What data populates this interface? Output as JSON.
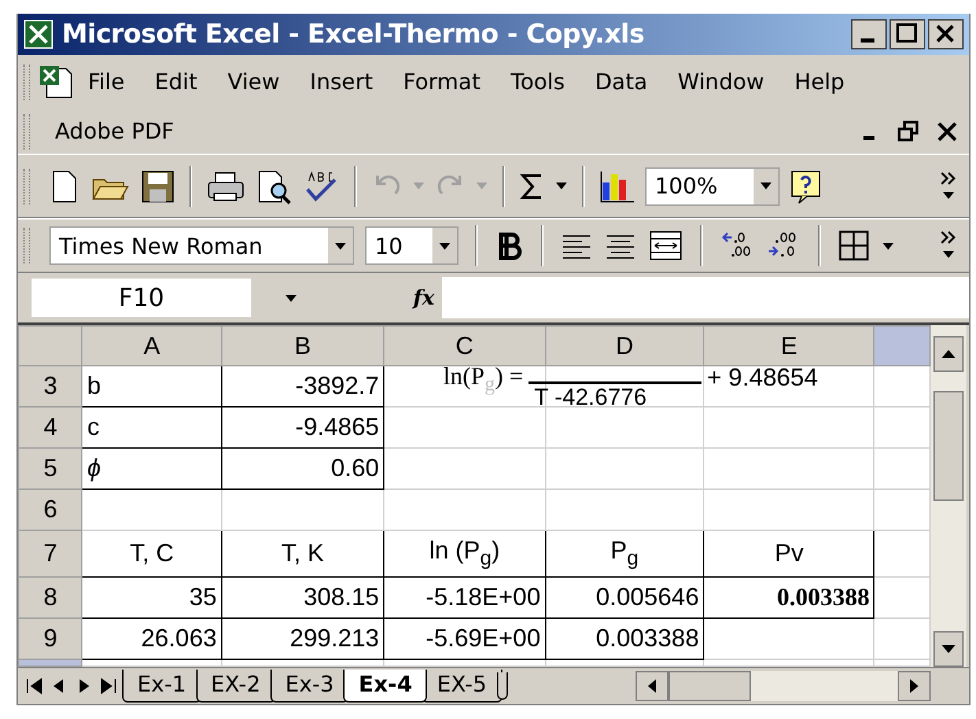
{
  "window": {
    "title": "Microsoft Excel - Excel-Thermo - Copy.xls"
  },
  "menu": [
    {
      "label": "File"
    },
    {
      "label": "Edit"
    },
    {
      "label": "View"
    },
    {
      "label": "Insert"
    },
    {
      "label": "Format"
    },
    {
      "label": "Tools"
    },
    {
      "label": "Data"
    },
    {
      "label": "Window"
    },
    {
      "label": "Help"
    }
  ],
  "second_menu": [
    {
      "label": "Adobe PDF"
    }
  ],
  "standard_toolbar": {
    "zoom": "100%",
    "undo_disabled": true
  },
  "formatting_toolbar": {
    "font": "Times New Roman",
    "size": "10"
  },
  "formula_bar": {
    "name_box": "F10",
    "fx": "fx"
  },
  "columns": [
    {
      "label": "A",
      "selected": false
    },
    {
      "label": "B",
      "selected": false
    },
    {
      "label": "C",
      "selected": false
    },
    {
      "label": "D",
      "selected": false
    },
    {
      "label": "E",
      "selected": false
    }
  ],
  "partial_column": {
    "selected": true
  },
  "rows": [
    {
      "number": "3",
      "cells": [
        {
          "text": "b",
          "kind": "label",
          "bold": false,
          "boxed": true
        },
        {
          "text": "-3892.7",
          "kind": "number",
          "bold": false,
          "boxed": true
        },
        {},
        {},
        {}
      ]
    },
    {
      "number": "4",
      "cells": [
        {
          "text": "c",
          "kind": "label",
          "bold": false,
          "boxed": true
        },
        {
          "text": "-9.4865",
          "kind": "number",
          "bold": false,
          "boxed": true
        },
        {},
        {},
        {}
      ]
    },
    {
      "number": "5",
      "cells": [
        {
          "text": "*ϕ*",
          "kind": "label",
          "bold": false,
          "boxed": true
        },
        {
          "text": "0.60",
          "kind": "number",
          "bold": false,
          "boxed": true
        },
        {},
        {},
        {}
      ]
    },
    {
      "number": "6",
      "cells": [
        {},
        {},
        {},
        {},
        {}
      ]
    },
    {
      "number": "7",
      "cells": [
        {
          "text": "T, C",
          "kind": "heading",
          "bold": false,
          "boxed": true
        },
        {
          "text": "T, K",
          "kind": "heading",
          "bold": false,
          "boxed": true
        },
        {
          "text": "ln (P$_{g}$)",
          "kind": "heading",
          "bold": false,
          "boxed": true
        },
        {
          "text": "P$_{g}$",
          "kind": "heading",
          "bold": false,
          "boxed": true
        },
        {
          "text": "Pv",
          "kind": "heading",
          "bold": false,
          "boxed": true
        }
      ]
    },
    {
      "number": "8",
      "cells": [
        {
          "text": "35",
          "kind": "number",
          "bold": false,
          "boxed": true
        },
        {
          "text": "308.15",
          "kind": "number",
          "bold": false,
          "boxed": true
        },
        {
          "text": "-5.18E+00",
          "kind": "number",
          "bold": false,
          "boxed": true
        },
        {
          "text": "0.005646",
          "kind": "number",
          "bold": false,
          "boxed": true
        },
        {
          "text": "0.003388",
          "kind": "number",
          "bold": true,
          "boxed": true
        }
      ]
    },
    {
      "number": "9",
      "cells": [
        {
          "text": "26.063",
          "kind": "number",
          "bold": false,
          "boxed": true
        },
        {
          "text": "299.213",
          "kind": "number",
          "bold": false,
          "boxed": true
        },
        {
          "text": "-5.69E+00",
          "kind": "number",
          "bold": false,
          "boxed": true
        },
        {
          "text": "0.003388",
          "kind": "number",
          "bold": false,
          "boxed": true
        },
        {}
      ]
    }
  ],
  "equation": {
    "left": "ln(P$_{g}$) =",
    "denominator": "T -42.6776",
    "right": "+ 9.48654"
  },
  "sheet_tabs": [
    {
      "label": "Ex-1",
      "selected": false
    },
    {
      "label": "EX-2",
      "selected": false
    },
    {
      "label": "Ex-3",
      "selected": false
    },
    {
      "label": "Ex-4",
      "selected": true
    },
    {
      "label": "EX-5",
      "selected": false
    }
  ]
}
